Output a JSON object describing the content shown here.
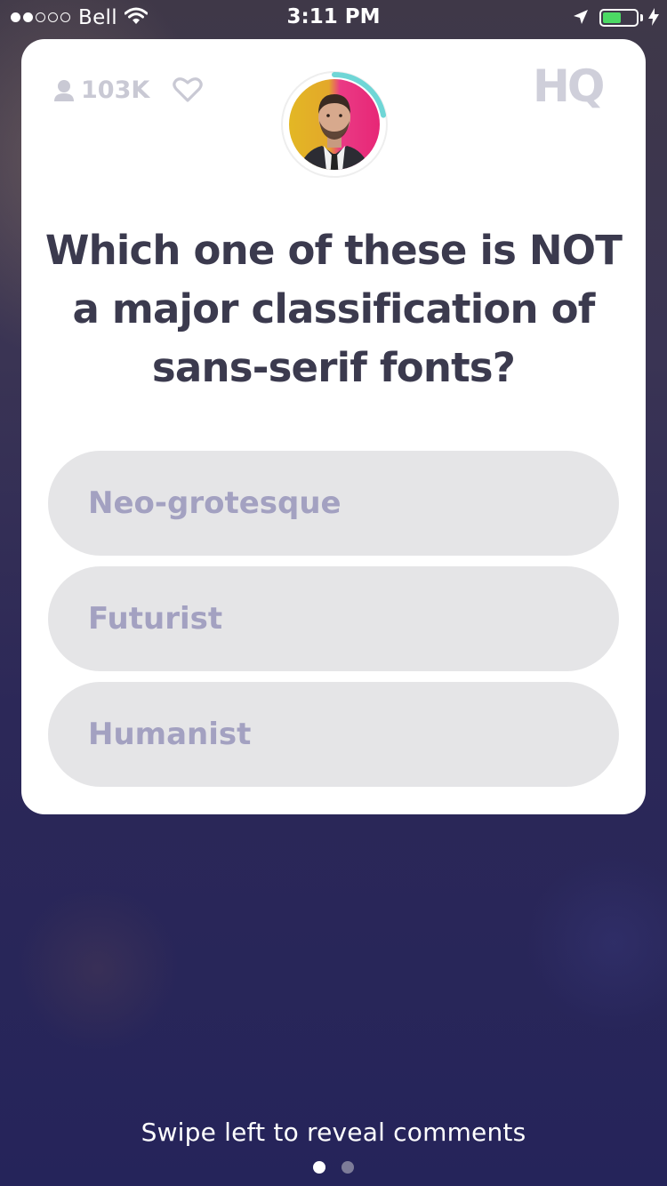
{
  "status_bar": {
    "carrier": "Bell",
    "time": "3:11 PM",
    "signal_bars": 2,
    "signal_total": 5,
    "battery_level": 0.55,
    "battery_color": "#4cd964"
  },
  "header": {
    "viewer_count": "103K",
    "logo": "HQ",
    "timer_progress": 0.22,
    "timer_color": "#6fd6d6"
  },
  "question": {
    "text": "Which one of these is NOT a major classification of sans-serif fonts?"
  },
  "answers": [
    {
      "label": "Neo-grotesque"
    },
    {
      "label": "Futurist"
    },
    {
      "label": "Humanist"
    }
  ],
  "footer": {
    "hint": "Swipe left to reveal comments",
    "page_count": 2,
    "active_page": 1
  },
  "colors": {
    "card": "#ffffff",
    "question_text": "#3b3a4e",
    "answer_bg": "#e5e5e7",
    "answer_text": "#a3a1c1",
    "background": "#2c2858"
  }
}
